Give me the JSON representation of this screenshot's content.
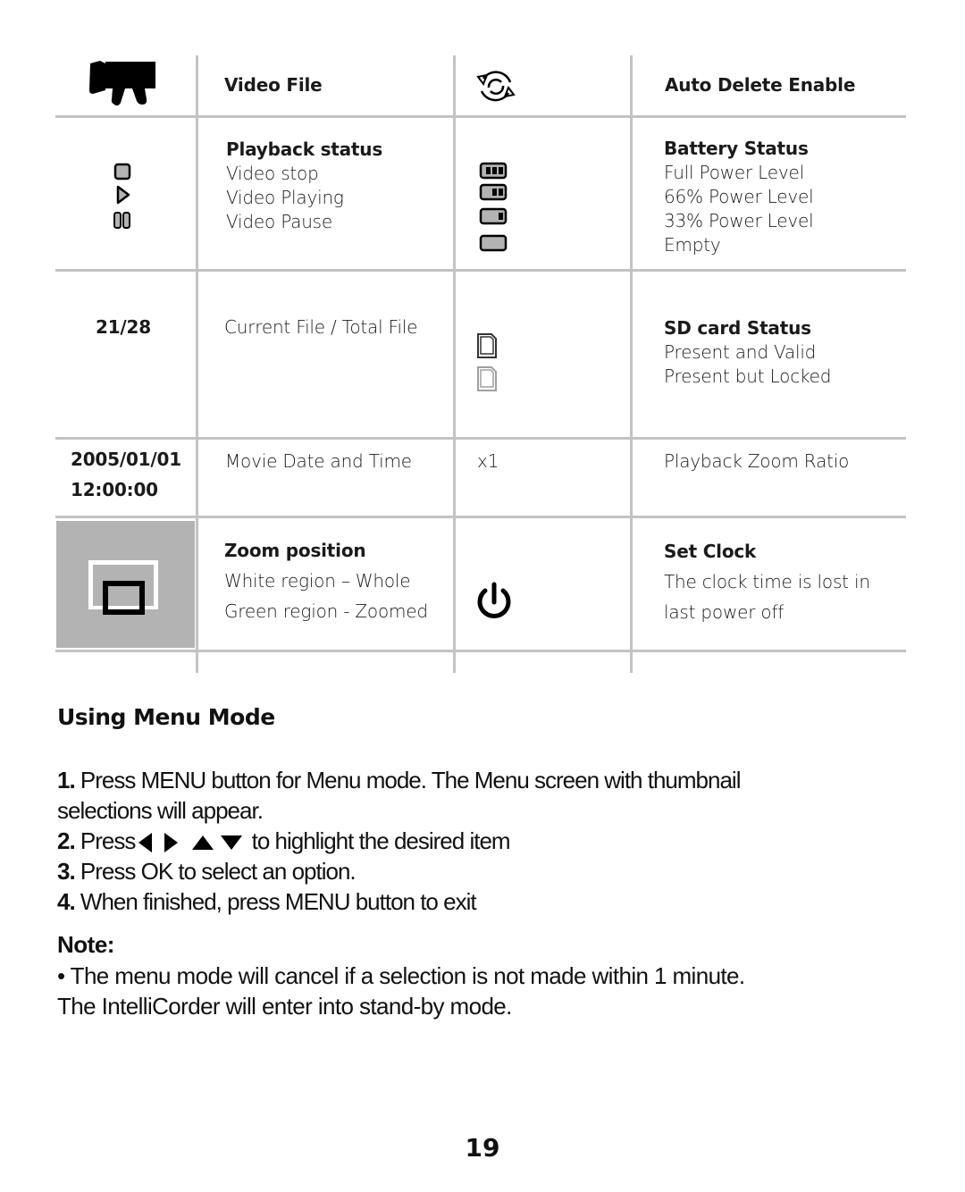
{
  "table": {
    "rows": [
      {
        "left_icon": "video-camera-icon",
        "left_text": "Video File",
        "right_icon": "auto-delete-cycle-icon",
        "right_text": "Auto Delete Enable"
      },
      {
        "left_icons": [
          "stop-icon",
          "play-icon",
          "pause-icon"
        ],
        "left_heading": "Playback status",
        "left_lines": [
          "Video stop",
          "Video Playing",
          "Video Pause"
        ],
        "right_icons": [
          "battery-full-icon",
          "battery-66-icon",
          "battery-33-icon",
          "battery-empty-icon"
        ],
        "right_heading": "Battery Status",
        "right_lines": [
          "Full Power Level",
          "66% Power Level",
          "33% Power Level",
          "Empty"
        ]
      },
      {
        "left_value": "21/28",
        "left_text": "Current File / Total File",
        "right_icons": [
          "sd-card-valid-icon",
          "sd-card-locked-icon"
        ],
        "right_heading": "SD card Status",
        "right_lines": [
          "Present and Valid",
          "Present but Locked"
        ]
      },
      {
        "left_value_lines": [
          "2005/01/01",
          "12:00:00"
        ],
        "left_text": "Movie Date and Time",
        "right_value": "x1",
        "right_text": "Playback Zoom Ratio"
      },
      {
        "left_icon": "zoom-position-icon",
        "left_heading": "Zoom position",
        "left_lines": [
          "White region – Whole",
          "Green region - Zoomed"
        ],
        "right_icon": "power-icon",
        "right_heading": "Set Clock",
        "right_lines": [
          "The clock time is lost in",
          "last power off"
        ]
      }
    ]
  },
  "menu_section": {
    "title": "Using Menu Mode",
    "steps": [
      {
        "num": "1.",
        "text": " Press MENU button for Menu mode. The Menu screen with thumbnail",
        "cont": "selections will appear."
      },
      {
        "num": "2.",
        "pre": " Press",
        "post": " to highlight the desired item"
      },
      {
        "num": "3.",
        "text": " Press OK to select an option."
      },
      {
        "num": "4.",
        "text": " When finished, press MENU button to exit"
      }
    ],
    "arrow_icons": [
      "arrow-left-icon",
      "arrow-right-icon",
      "arrow-up-icon",
      "arrow-down-icon"
    ]
  },
  "note": {
    "title": "Note:",
    "line1": "• The menu mode will cancel if a selection is not made within 1 minute.",
    "line2": "The IntelliCorder will enter into stand-by mode."
  },
  "page_number": "19"
}
